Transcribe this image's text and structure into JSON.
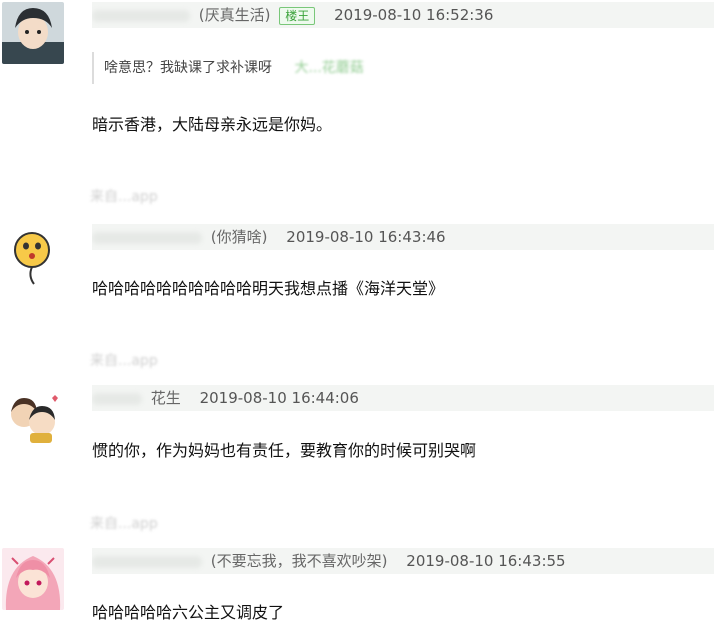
{
  "comments": [
    {
      "nickname_suffix": "(厌真生活)",
      "badge": "楼王",
      "timestamp": "2019-08-10 16:52:36",
      "quote": {
        "text": "啥意思？我缺课了求补课呀",
        "author": "大...花蘑菇"
      },
      "content": "暗示香港，大陆母亲永远是你妈。"
    },
    {
      "source_app": "来自...app",
      "nickname_suffix": "(你猜啥)",
      "timestamp": "2019-08-10 16:43:46",
      "content": "哈哈哈哈哈哈哈哈哈哈明天我想点播《海洋天堂》"
    },
    {
      "source_app": "来自...app",
      "nickname_suffix": "花生",
      "timestamp": "2019-08-10 16:44:06",
      "content": "惯的你，作为妈妈也有责任，要教育你的时候可别哭啊"
    },
    {
      "source_app": "来自...app",
      "nickname_suffix": "(不要忘我，我不喜欢吵架)",
      "timestamp": "2019-08-10 16:43:55",
      "content": "哈哈哈哈哈六公主又调皮了"
    }
  ],
  "colors": {
    "meta_bar_bg": "#f3f5f3",
    "badge_green": "#3aa33a",
    "source_text": "#cfcfcf"
  },
  "icons": [
    "avatar-anime-boy",
    "avatar-yellow-emoji",
    "avatar-couple-cartoon",
    "avatar-pink-anime-girl"
  ]
}
